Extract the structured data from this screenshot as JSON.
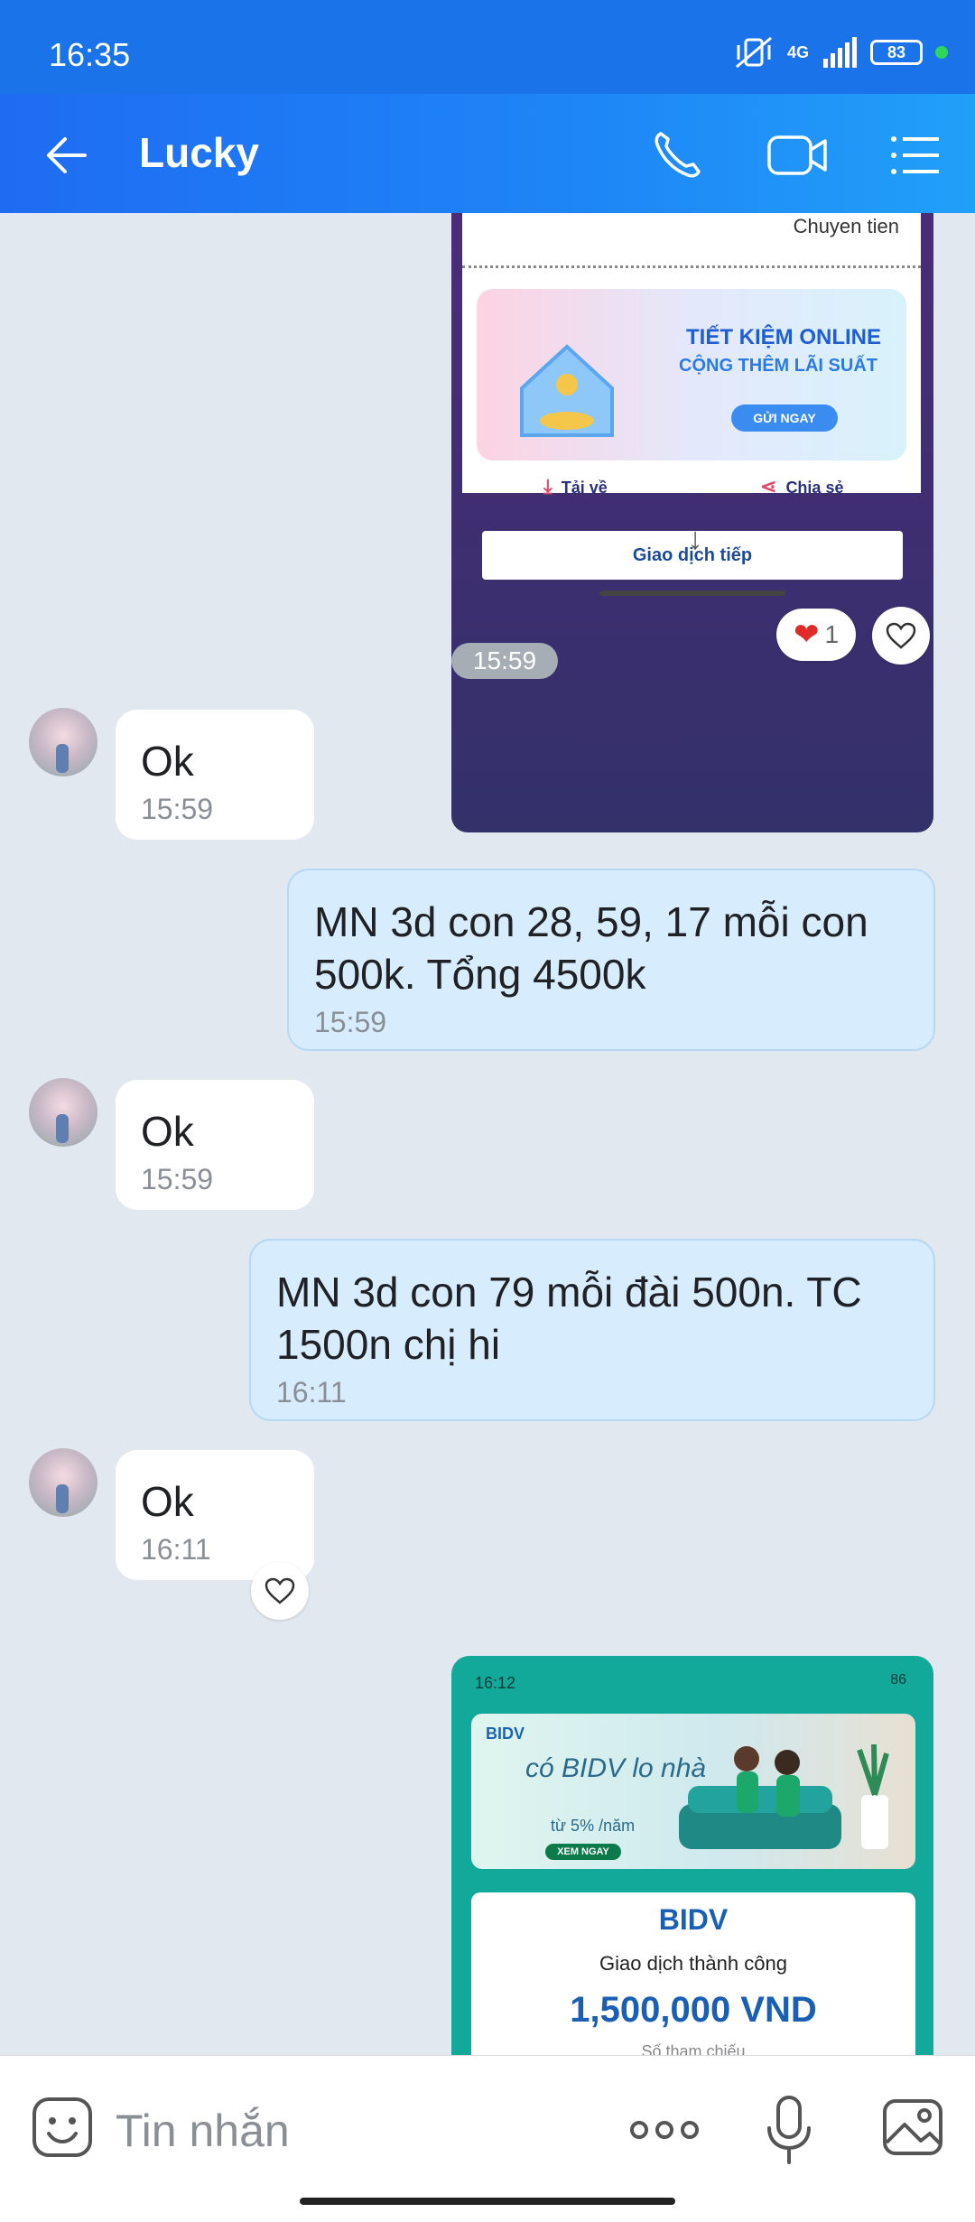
{
  "status_bar": {
    "time": "16:35",
    "network": "4G",
    "battery": "83"
  },
  "app_bar": {
    "title": "Lucky"
  },
  "receipt_top": {
    "label": "Chuyen tien",
    "promo_title": "TIẾT KIỆM ONLINE",
    "promo_subtitle": "CỘNG THÊM LÃI SUẤT",
    "promo_button": "GỬI NGAY",
    "download": "Tải về",
    "share": "Chia sẻ",
    "next": "Giao dịch tiếp"
  },
  "reaction": {
    "count": "1"
  },
  "time_chip": "15:59",
  "messages": [
    {
      "text": "Ok",
      "time": "15:59"
    },
    {
      "text": "MN 3d con 28, 59, 17 mỗi con 500k. Tổng 4500k",
      "time": "15:59"
    },
    {
      "text": "Ok",
      "time": "15:59"
    },
    {
      "text": "MN 3d con 79 mỗi đài 500n. TC 1500n chị hi",
      "time": "16:11"
    },
    {
      "text": "Ok",
      "time": "16:11"
    }
  ],
  "bidv_receipt": {
    "status_time": "16:12",
    "status_battery": "86",
    "banner_logo": "BIDV",
    "banner_slogan": "có BIDV lo nhà",
    "banner_rate": "từ 5% /năm",
    "banner_cta": "XEM NGAY",
    "logo": "BIDV",
    "success": "Giao dịch thành công",
    "amount": "1,500,000 VND",
    "ref_label": "Số tham chiếu"
  },
  "input_bar": {
    "placeholder": "Tin nhắn"
  }
}
